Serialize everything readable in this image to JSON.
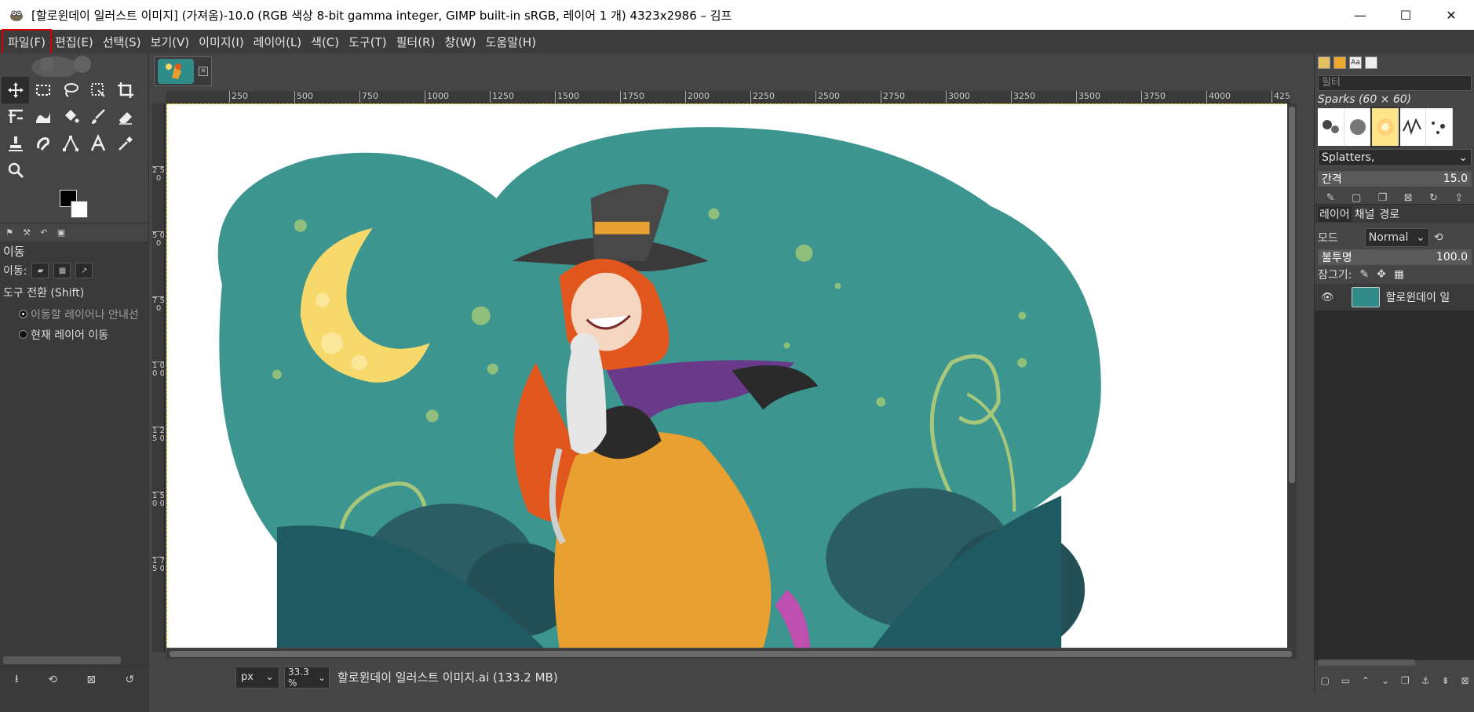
{
  "window": {
    "title": "[할로윈데이 일러스트 이미지] (가져옴)-10.0 (RGB 색상 8-bit gamma integer, GIMP built-in sRGB, 레이어 1 개) 4323x2986 – 김프",
    "minimize": "—",
    "maximize": "☐",
    "close": "✕"
  },
  "menu": [
    {
      "label": "파일(F)"
    },
    {
      "label": "편집(E)"
    },
    {
      "label": "선택(S)"
    },
    {
      "label": "보기(V)"
    },
    {
      "label": "이미지(I)"
    },
    {
      "label": "레이어(L)"
    },
    {
      "label": "색(C)"
    },
    {
      "label": "도구(T)"
    },
    {
      "label": "필터(R)"
    },
    {
      "label": "창(W)"
    },
    {
      "label": "도움말(H)"
    }
  ],
  "tool_options": {
    "title": "이동",
    "move_label": "이동:",
    "tool_toggle": "도구 전환  (Shift)",
    "radio_pick": "이동할 레이어나 안내선",
    "radio_active": "현재 레이어 이동"
  },
  "ruler": {
    "top": [
      "250",
      "500",
      "750",
      "1000",
      "1250",
      "1500",
      "1750",
      "2000",
      "2250",
      "2500",
      "2750",
      "3000",
      "3250",
      "3500",
      "3750",
      "4000",
      "425"
    ],
    "left": [
      "2 5 0",
      "5 0 0",
      "7 5 0",
      "1 0 0 0",
      "1 2 5 0",
      "1 5 0 0",
      "1 7 5 0"
    ]
  },
  "status": {
    "unit": "px",
    "zoom": "33.3 %",
    "text": "할로윈데이 일러스트 이미지.ai (133.2 MB)"
  },
  "brushes": {
    "filter_placeholder": "필터",
    "brush_name": "Sparks (60 × 60)",
    "preset": "Splatters,",
    "spacing_label": "간격",
    "spacing_value": "15.0"
  },
  "layers": {
    "tab_layers": "레이어",
    "tab_channels": "채널",
    "tab_paths": "경로",
    "mode_label": "모드",
    "mode_value": "Normal",
    "opacity_label": "불투명",
    "opacity_value": "100.0",
    "lock_label": "잠그기:",
    "items": [
      {
        "name": "할로윈데이 일"
      }
    ]
  }
}
